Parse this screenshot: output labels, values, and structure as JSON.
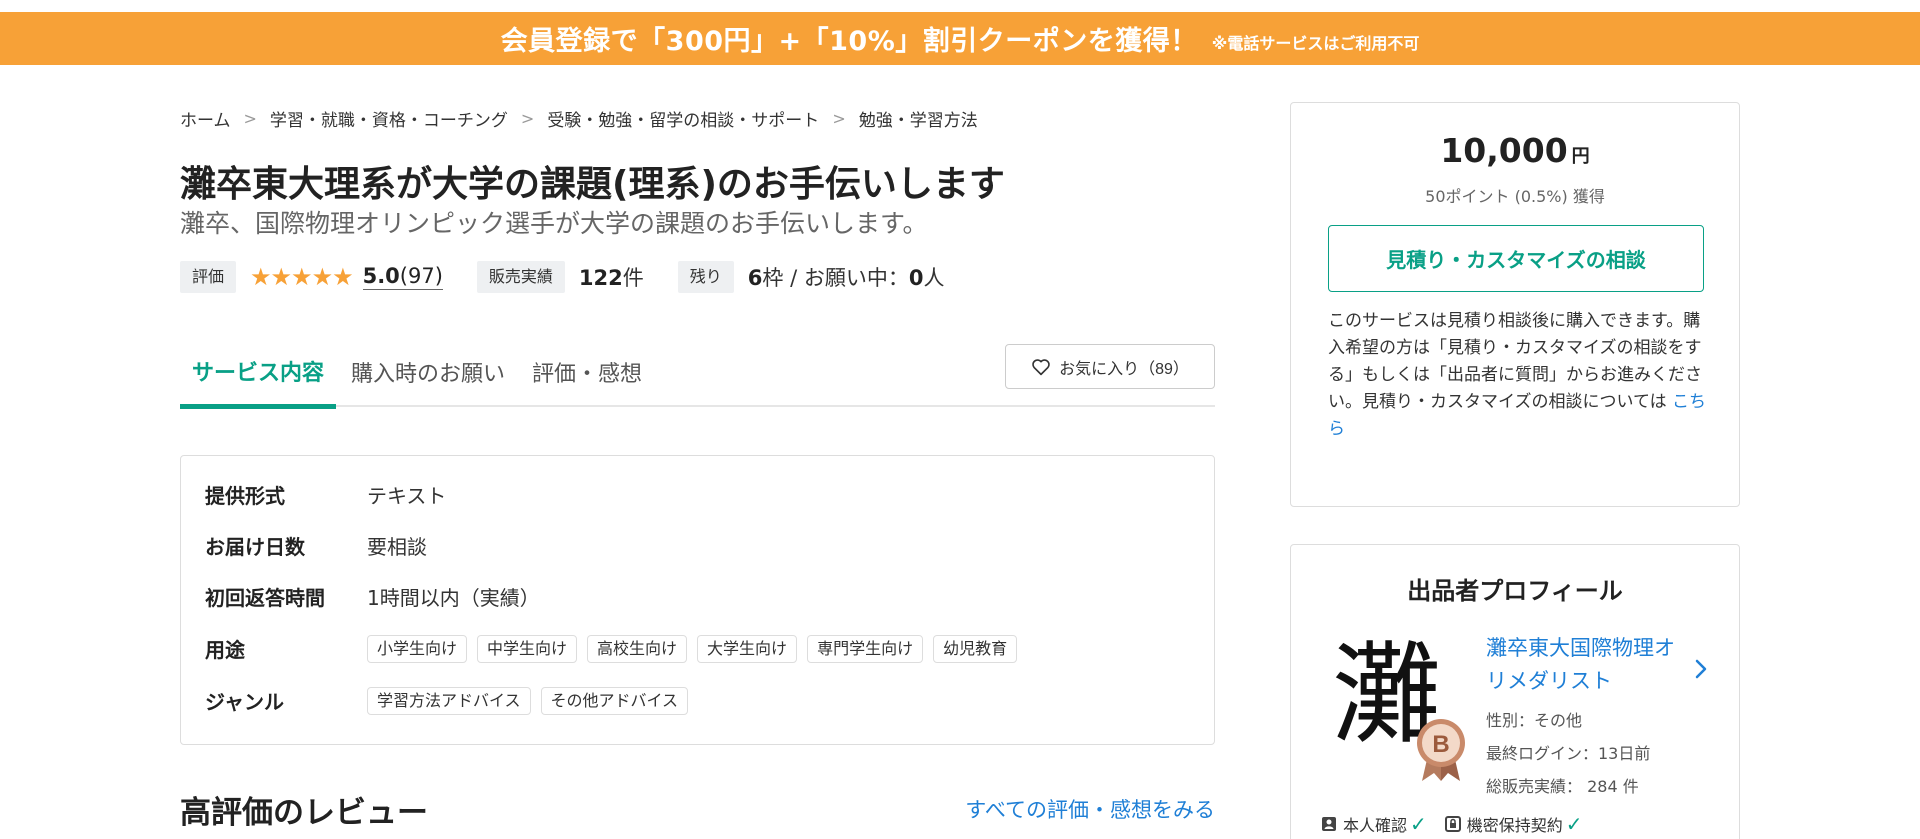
{
  "banner": {
    "main": "会員登録で「300円」+「10%」割引クーポンを獲得！",
    "note": "※電話サービスはご利用不可"
  },
  "breadcrumb": [
    "ホーム",
    "学習・就職・資格・コーチング",
    "受験・勉強・留学の相談・サポート",
    "勉強・学習方法"
  ],
  "breadcrumb_separator": ">",
  "title": "灘卒東大理系が大学の課題(理系)のお手伝いします",
  "subtitle": "灘卒、国際物理オリンピック選手が大学の課題のお手伝いします。",
  "stats": {
    "rating_label": "評価",
    "stars": "★★★★★",
    "rating_value": "5.0",
    "rating_count": "(97)",
    "sales_label": "販売実績",
    "sales_value": "122",
    "sales_unit": "件",
    "remaining_label": "残り",
    "remaining_value": "6",
    "remaining_unit": "枠 / お願い中：",
    "requests_value": "0",
    "requests_unit": "人"
  },
  "tabs": [
    "サービス内容",
    "購入時のお願い",
    "評価・感想"
  ],
  "favorite": {
    "label": "お気に入り（89）"
  },
  "details": {
    "format_label": "提供形式",
    "format_value": "テキスト",
    "delivery_label": "お届け日数",
    "delivery_value": "要相談",
    "response_label": "初回返答時間",
    "response_value": "1時間以内（実績）",
    "usage_label": "用途",
    "usage_chips": [
      "小学生向け",
      "中学生向け",
      "高校生向け",
      "大学生向け",
      "専門学生向け",
      "幼児教育"
    ],
    "genre_label": "ジャンル",
    "genre_chips": [
      "学習方法アドバイス",
      "その他アドバイス"
    ]
  },
  "reviews": {
    "heading": "高評価のレビュー",
    "all_link": "すべての評価・感想をみる"
  },
  "buybox": {
    "price": "10,000",
    "currency": "円",
    "points": "50ポイント (0.5%) 獲得",
    "consult_button": "見積り・カスタマイズの相談",
    "info_text": "このサービスは見積り相談後に購入できます。購入希望の方は「見積り・カスタマイズの相談をする」もしくは「出品者に質問」からお進みください。見積り・カスタマイズの相談については ",
    "info_link": "こちら"
  },
  "profile": {
    "heading": "出品者プロフィール",
    "avatar_char": "灘",
    "badge_letter": "B",
    "name": "灘卒東大国際物理オリメダリスト",
    "gender": "性別：その他",
    "last_login": "最終ログイン：13日前",
    "total_sales": "総販売実績： 284 件",
    "verify_identity": "本人確認",
    "verify_nda": "機密保持契約"
  },
  "colors": {
    "accent": "#09a086",
    "banner": "#f7a137",
    "link": "#1f7fd6",
    "star": "#f7a137"
  }
}
